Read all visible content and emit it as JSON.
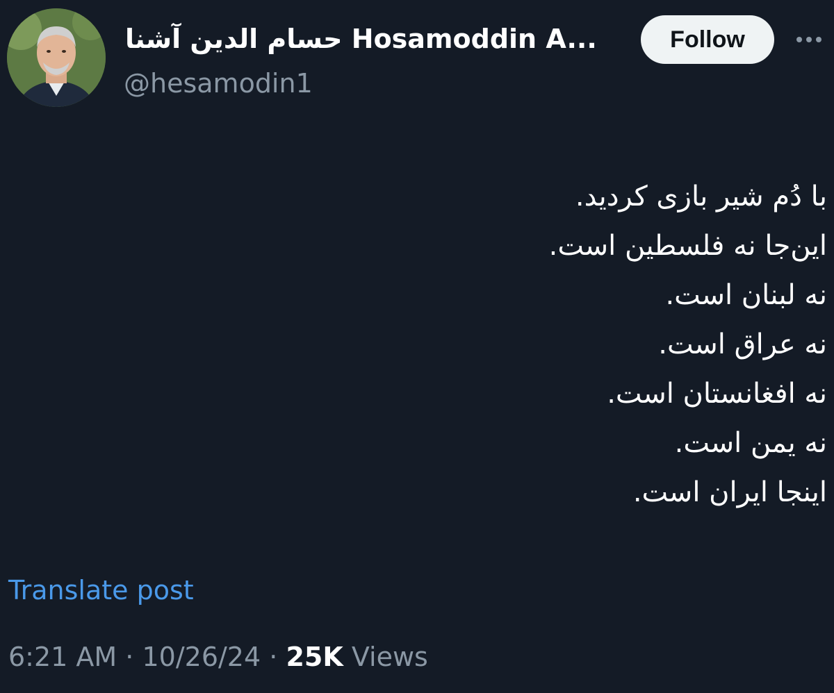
{
  "author": {
    "display_name": "حسام الدین آشنا Hosamoddin A...",
    "handle": "@hesamodin1",
    "avatar_icon": "profile-photo"
  },
  "actions": {
    "follow_label": "Follow",
    "more_icon": "more-dots-icon"
  },
  "tweet": {
    "lines": [
      "با دُم شیر بازی کردید.",
      "این‌جا نه فلسطین است.",
      "نه لبنان است.",
      "نه عراق است.",
      "نه افغانستان است.",
      "نه یمن است.",
      "اینجا ایران است."
    ]
  },
  "translate_label": "Translate post",
  "meta": {
    "time": "6:21 AM",
    "separator": "·",
    "date": "10/26/24",
    "views_count": "25K",
    "views_label": "Views"
  },
  "colors": {
    "background": "#141b26",
    "link": "#4a99e9",
    "muted": "#8b98a5"
  }
}
